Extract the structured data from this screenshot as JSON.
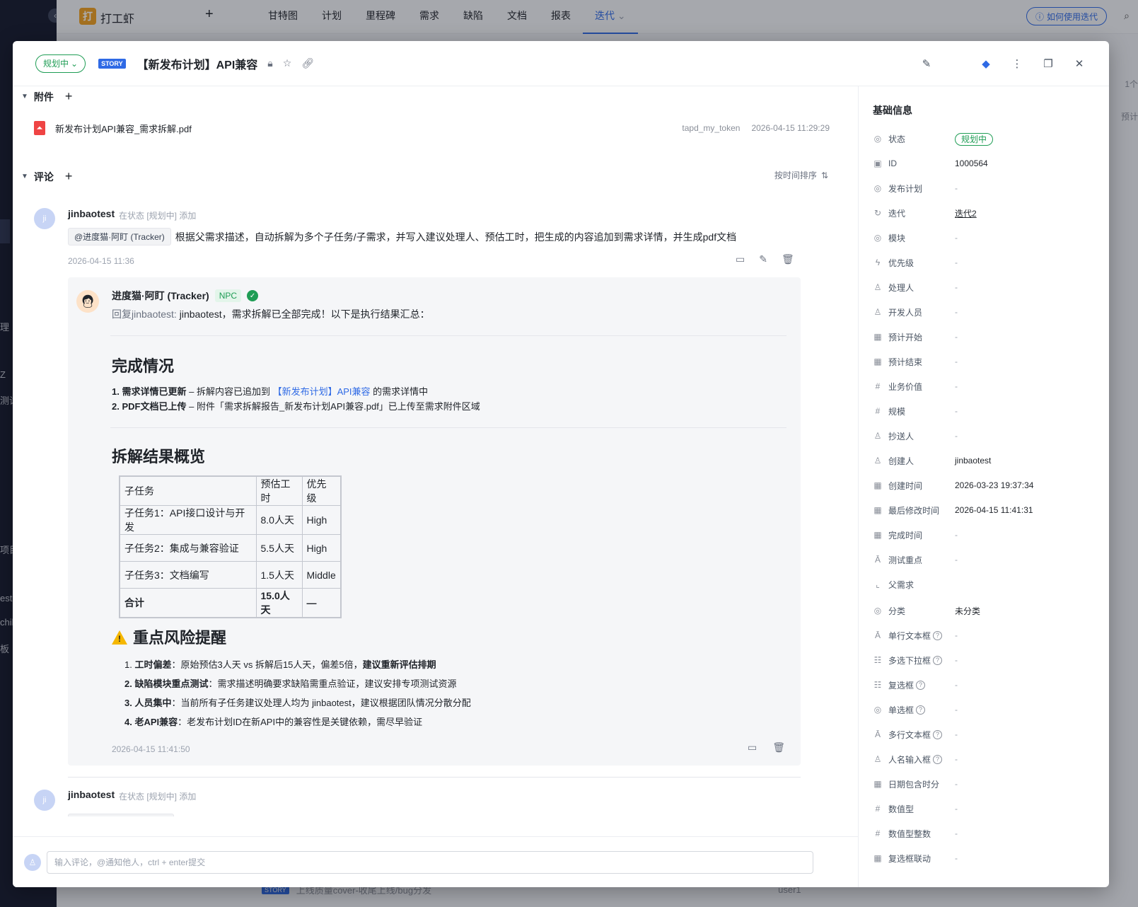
{
  "app": {
    "logo_char": "打",
    "name": "打工虾",
    "add": "+"
  },
  "nav": [
    "甘特图",
    "计划",
    "里程碑",
    "需求",
    "缺陷",
    "文档",
    "报表",
    "迭代"
  ],
  "nav_active_arrow": "⌄",
  "howto": "如何使用迭代",
  "bg_fragments": {
    "left": [
      "理",
      "Z",
      "测试",
      "项目",
      "est",
      "chil",
      "板"
    ],
    "right": [
      "1个",
      "预计"
    ],
    "bottom_tag": "STORY",
    "bottom_text": "上线质量cover-收尾上线/bug分发",
    "bottom_user": "user1"
  },
  "modal": {
    "status": "规划中",
    "story_tag": "STORY",
    "title": "【新发布计划】API兼容"
  },
  "attachments": {
    "heading": "附件",
    "file_name": "新发布计划API兼容_需求拆解.pdf",
    "uploader": "tapd_my_token",
    "uploaded_at": "2026-04-15 11:29:29"
  },
  "comments": {
    "heading": "评论",
    "sort_label": "按时间排序",
    "first": {
      "avatar": "ji",
      "author": "jinbaotest",
      "meta": "在状态 [规划中] 添加",
      "mention": "@进度猫·阿盯 (Tracker)",
      "body": "根据父需求描述，自动拆解为多个子任务/子需求，并写入建议处理人、预估工时，把生成的内容追加到需求详情，并生成pdf文档",
      "time": "2026-04-15 11:36"
    },
    "reply": {
      "author": "进度猫·阿盯 (Tracker)",
      "badge": "NPC",
      "reply_prefix": "回复jinbaotest:",
      "reply_text": "jinbaotest，需求拆解已全部完成！以下是执行结果汇总：",
      "h_done": "完成情况",
      "done1_num": "1.",
      "done1_bold": "需求详情已更新",
      "done1_pre": " – 拆解内容已追加到 ",
      "done1_link": "【新发布计划】API兼容",
      "done1_post": " 的需求详情中",
      "done2_num": "2.",
      "done2_bold": "PDF文档已上传",
      "done2_text": " – 附件「需求拆解报告_新发布计划API兼容.pdf」已上传至需求附件区域",
      "h_overview": "拆解结果概览",
      "table": {
        "headers": [
          "子任务",
          "预估工时",
          "优先级"
        ],
        "rows": [
          [
            "子任务1：API接口设计与开发",
            "8.0人天",
            "High"
          ],
          [
            "子任务2：集成与兼容验证",
            "5.5人天",
            "High"
          ],
          [
            "子任务3：文档编写",
            "1.5人天",
            "Middle"
          ]
        ],
        "total": [
          "合计",
          "15.0人天",
          "—"
        ]
      },
      "h_risk": "重点风险提醒",
      "risks": [
        {
          "num": "1.",
          "bold": "工时偏差",
          "text": "：原始预估3人天 vs 拆解后15人天，偏差5倍，",
          "bold2": "建议重新评估排期"
        },
        {
          "num": "2.",
          "bold": "缺陷模块重点测试",
          "text": "：需求描述明确要求缺陷需重点验证，建议安排专项测试资源",
          "bold2": ""
        },
        {
          "num": "3.",
          "bold": "人员集中",
          "text": "：当前所有子任务建议处理人均为 jinbaotest，建议根据团队情况分散分配",
          "bold2": ""
        },
        {
          "num": "4.",
          "bold": "老API兼容",
          "text": "：老发布计划ID在新API中的兼容性是关键依赖，需尽早验证",
          "bold2": ""
        }
      ],
      "time": "2026-04-15 11:41:50"
    },
    "second": {
      "avatar": "ji",
      "author": "jinbaotest",
      "meta": "在状态 [规划中] 添加"
    },
    "input_placeholder": "输入评论，@通知他人，ctrl + enter提交"
  },
  "info": {
    "title": "基础信息",
    "fields": [
      {
        "icon": "◎",
        "label": "状态",
        "value": "规划中",
        "kind": "status"
      },
      {
        "icon": "▣",
        "label": "ID",
        "value": "1000564"
      },
      {
        "icon": "◎",
        "label": "发布计划",
        "value": "-",
        "kind": "empty"
      },
      {
        "icon": "↻",
        "label": "迭代",
        "value": "迭代2",
        "kind": "link"
      },
      {
        "icon": "◎",
        "label": "模块",
        "value": "-",
        "kind": "empty"
      },
      {
        "icon": "ϟ",
        "label": "优先级",
        "value": "-",
        "kind": "empty"
      },
      {
        "icon": "♙",
        "label": "处理人",
        "value": "-",
        "kind": "empty"
      },
      {
        "icon": "♙",
        "label": "开发人员",
        "value": "-",
        "kind": "empty"
      },
      {
        "icon": "▦",
        "label": "预计开始",
        "value": "-",
        "kind": "empty"
      },
      {
        "icon": "▦",
        "label": "预计结束",
        "value": "-",
        "kind": "empty"
      },
      {
        "icon": "#",
        "label": "业务价值",
        "value": "-",
        "kind": "empty"
      },
      {
        "icon": "#",
        "label": "规模",
        "value": "-",
        "kind": "empty"
      },
      {
        "icon": "♙",
        "label": "抄送人",
        "value": "-",
        "kind": "empty"
      },
      {
        "icon": "♙",
        "label": "创建人",
        "value": "jinbaotest"
      },
      {
        "icon": "▦",
        "label": "创建时间",
        "value": "2026-03-23 19:37:34"
      },
      {
        "icon": "▦",
        "label": "最后修改时间",
        "value": "2026-04-15 11:41:31"
      },
      {
        "icon": "▦",
        "label": "完成时间",
        "value": "-",
        "kind": "empty"
      },
      {
        "icon": "Ā",
        "label": "测试重点",
        "value": "-",
        "kind": "empty"
      },
      {
        "icon": "⌞",
        "label": "父需求",
        "value": ""
      },
      {
        "icon": "◎",
        "label": "分类",
        "value": "未分类"
      },
      {
        "icon": "Ā",
        "label": "单行文本框",
        "value": "-",
        "kind": "empty",
        "help": "?"
      },
      {
        "icon": "☷",
        "label": "多选下拉框",
        "value": "-",
        "kind": "empty",
        "help": "?"
      },
      {
        "icon": "☷",
        "label": "复选框",
        "value": "-",
        "kind": "empty",
        "help": "?"
      },
      {
        "icon": "◎",
        "label": "单选框",
        "value": "-",
        "kind": "empty",
        "help": "?"
      },
      {
        "icon": "Ā",
        "label": "多行文本框",
        "value": "-",
        "kind": "empty",
        "help": "?"
      },
      {
        "icon": "♙",
        "label": "人名输入框",
        "value": "-",
        "kind": "empty",
        "help": "?"
      },
      {
        "icon": "▦",
        "label": "日期包含时分",
        "value": "-",
        "kind": "empty"
      },
      {
        "icon": "#",
        "label": "数值型",
        "value": "-",
        "kind": "empty"
      },
      {
        "icon": "#",
        "label": "数值型整数",
        "value": "-",
        "kind": "empty"
      },
      {
        "icon": "▦",
        "label": "复选框联动",
        "value": "-",
        "kind": "empty"
      }
    ]
  }
}
